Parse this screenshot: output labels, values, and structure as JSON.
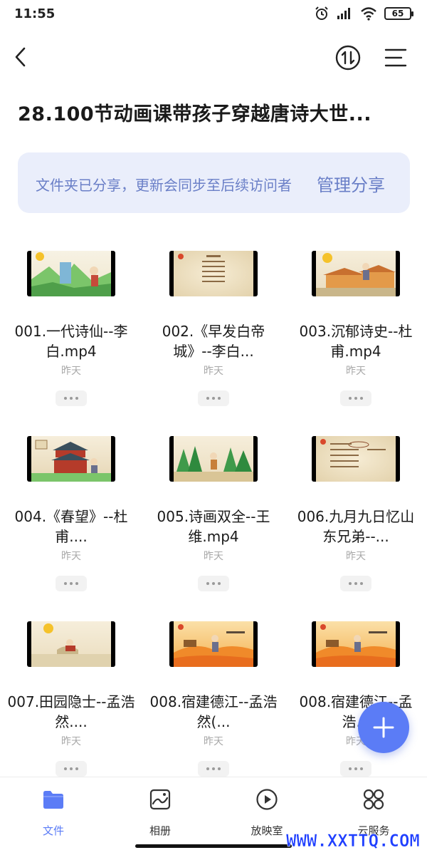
{
  "status_bar": {
    "time": "11:55",
    "network": "HD 4G",
    "battery": "65"
  },
  "header": {
    "back_icon": "chevron-left-icon",
    "sort_icon": "sort-arrows-icon",
    "menu_icon": "menu-icon"
  },
  "page": {
    "title": "28.100节动画课带孩子穿越唐诗大世..."
  },
  "share_banner": {
    "text": "文件夹已分享，更新会同步至后续访问者",
    "manage_label": "管理分享",
    "color": "#6a7fc7",
    "background": "#eaeefb"
  },
  "files": [
    {
      "name": "001.一代诗仙--李白.mp4",
      "date": "昨天"
    },
    {
      "name": "002.《早发白帝城》--李白...",
      "date": "昨天"
    },
    {
      "name": "003.沉郁诗史--杜甫.mp4",
      "date": "昨天"
    },
    {
      "name": "004.《春望》--杜甫....",
      "date": "昨天"
    },
    {
      "name": "005.诗画双全--王维.mp4",
      "date": "昨天"
    },
    {
      "name": "006.九月九日忆山东兄弟--...",
      "date": "昨天"
    },
    {
      "name": "007.田园隐士--孟浩然....",
      "date": "昨天"
    },
    {
      "name": "008.宿建德江--孟浩然(...",
      "date": "昨天"
    },
    {
      "name": "008.宿建德江--孟浩...",
      "date": "昨天"
    }
  ],
  "fab": {
    "icon": "plus-icon",
    "color": "#5b7cf6"
  },
  "bottom_nav": [
    {
      "label": "文件",
      "icon": "folder-icon",
      "active": true
    },
    {
      "label": "相册",
      "icon": "photo-album-icon",
      "active": false
    },
    {
      "label": "放映室",
      "icon": "play-circle-icon",
      "active": false
    },
    {
      "label": "云服务",
      "icon": "grid-circles-icon",
      "active": false
    }
  ],
  "watermark": "WWW.XXTTQ.COM",
  "accent_color": "#5b7cf6"
}
